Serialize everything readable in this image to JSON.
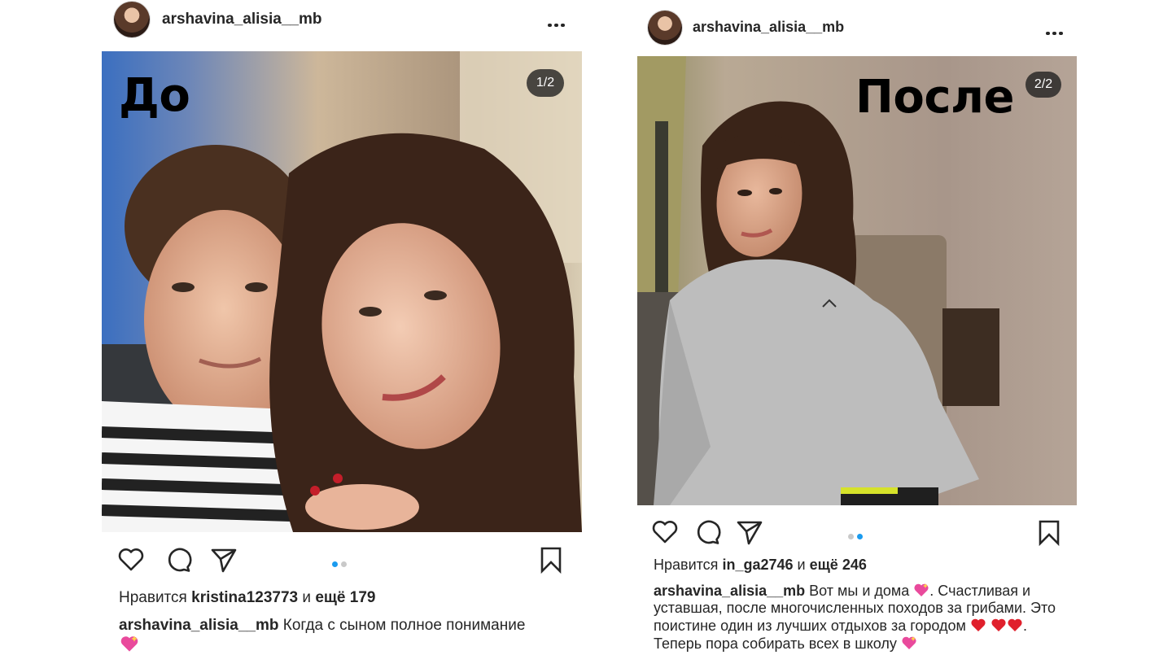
{
  "posts": [
    {
      "username": "arshavina_alisia__mb",
      "overlay_word": "До",
      "carousel_counter": "1/2",
      "carousel": {
        "count": 2,
        "active": 0
      },
      "likes": {
        "prefix": "Нравится",
        "user": "kristina123773",
        "joiner": "и",
        "more": "ещё 179"
      },
      "caption": {
        "user": "arshavina_alisia__mb",
        "text": "Когда с сыном полное понимание"
      },
      "icons": [
        "heart-icon",
        "comment-icon",
        "share-icon",
        "bookmark-icon",
        "more-icon"
      ]
    },
    {
      "username": "arshavina_alisia__mb",
      "overlay_word": "После",
      "carousel_counter": "2/2",
      "carousel": {
        "count": 2,
        "active": 1
      },
      "likes": {
        "prefix": "Нравится",
        "user": "in_ga2746",
        "joiner": "и",
        "more": "ещё 246"
      },
      "caption": {
        "user": "arshavina_alisia__mb",
        "part1": "Вот мы и дома",
        "part2": ". Счастливая и уставшая, после многочисленных походов за грибами. Это поистине один из лучших отдыхов за городом",
        "part3": ". Теперь пора собирать всех в школу"
      },
      "icons": [
        "heart-icon",
        "comment-icon",
        "share-icon",
        "bookmark-icon",
        "more-icon"
      ]
    }
  ],
  "colors": {
    "text": "#262626",
    "active_dot": "#1a9bef",
    "inactive_dot": "#c9c9c9",
    "emoji_pink": "#e94a9c",
    "emoji_red": "#e0202c"
  }
}
